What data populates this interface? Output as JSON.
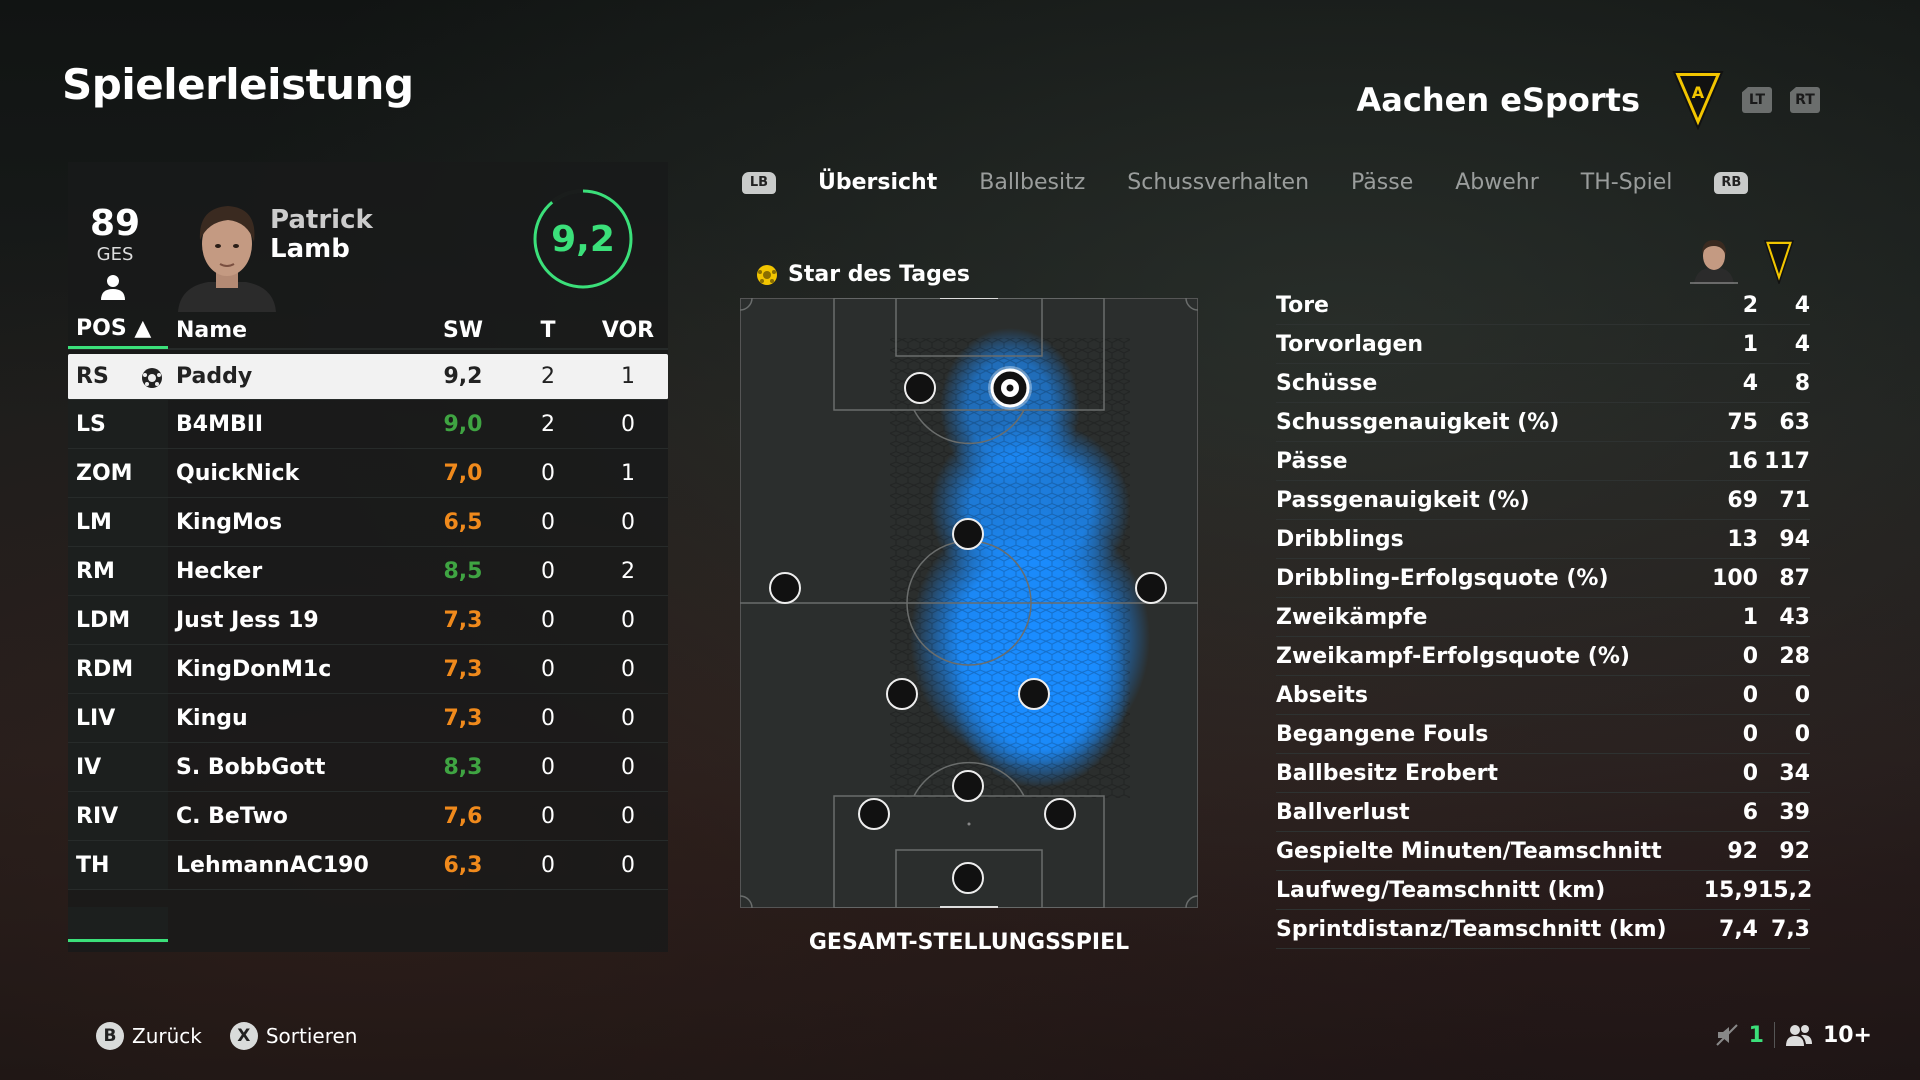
{
  "page_title": "Spielerleistung",
  "team": {
    "name": "Aachen eSports",
    "lt": "LT",
    "rt": "RT"
  },
  "player": {
    "ges_value": "89",
    "ges_label": "GES",
    "first_name": "Patrick",
    "last_name": "Lamb",
    "rating": "9,2"
  },
  "table": {
    "headers": {
      "pos": "POS ▲",
      "name": "Name",
      "sw": "SW",
      "t": "T",
      "vor": "VOR"
    },
    "rows": [
      {
        "pos": "RS",
        "name": "Paddy",
        "sw": "9,2",
        "t": "2",
        "vor": "1",
        "sw_color": "#222222"
      },
      {
        "pos": "LS",
        "name": "B4MBII",
        "sw": "9,0",
        "t": "2",
        "vor": "0",
        "sw_color": "#3fa442"
      },
      {
        "pos": "ZOM",
        "name": "QuickNick",
        "sw": "7,0",
        "t": "0",
        "vor": "1",
        "sw_color": "#f08a1c"
      },
      {
        "pos": "LM",
        "name": "KingMos",
        "sw": "6,5",
        "t": "0",
        "vor": "0",
        "sw_color": "#f08a1c"
      },
      {
        "pos": "RM",
        "name": "Hecker",
        "sw": "8,5",
        "t": "0",
        "vor": "2",
        "sw_color": "#3fa442"
      },
      {
        "pos": "LDM",
        "name": "Just Jess 19",
        "sw": "7,3",
        "t": "0",
        "vor": "0",
        "sw_color": "#f08a1c"
      },
      {
        "pos": "RDM",
        "name": "KingDonM1c",
        "sw": "7,3",
        "t": "0",
        "vor": "0",
        "sw_color": "#f08a1c"
      },
      {
        "pos": "LIV",
        "name": "Kingu",
        "sw": "7,3",
        "t": "0",
        "vor": "0",
        "sw_color": "#f08a1c"
      },
      {
        "pos": "IV",
        "name": "S. BobbGott",
        "sw": "8,3",
        "t": "0",
        "vor": "0",
        "sw_color": "#3fa442"
      },
      {
        "pos": "RIV",
        "name": "C. BeTwo",
        "sw": "7,6",
        "t": "0",
        "vor": "0",
        "sw_color": "#f08a1c"
      },
      {
        "pos": "TH",
        "name": "LehmannAC190",
        "sw": "6,3",
        "t": "0",
        "vor": "0",
        "sw_color": "#f08a1c"
      }
    ]
  },
  "tabs": {
    "lb": "LB",
    "rb": "RB",
    "items": [
      "Übersicht",
      "Ballbesitz",
      "Schussverhalten",
      "Pässe",
      "Abwehr",
      "TH-Spiel"
    ],
    "active": "Übersicht"
  },
  "pitch": {
    "star_label": "Star des Tages",
    "caption": "GESAMT-STELLUNGSSPIEL"
  },
  "stats": [
    {
      "label": "Tore",
      "player": "2",
      "team": "4"
    },
    {
      "label": "Torvorlagen",
      "player": "1",
      "team": "4"
    },
    {
      "label": "Schüsse",
      "player": "4",
      "team": "8"
    },
    {
      "label": "Schussgenauigkeit (%)",
      "player": "75",
      "team": "63"
    },
    {
      "label": "Pässe",
      "player": "16",
      "team": "117"
    },
    {
      "label": "Passgenauigkeit (%)",
      "player": "69",
      "team": "71"
    },
    {
      "label": "Dribblings",
      "player": "13",
      "team": "94"
    },
    {
      "label": "Dribbling-Erfolgsquote (%)",
      "player": "100",
      "team": "87"
    },
    {
      "label": "Zweikämpfe",
      "player": "1",
      "team": "43"
    },
    {
      "label": "Zweikampf-Erfolgsquote (%)",
      "player": "0",
      "team": "28"
    },
    {
      "label": "Abseits",
      "player": "0",
      "team": "0"
    },
    {
      "label": "Begangene Fouls",
      "player": "0",
      "team": "0"
    },
    {
      "label": "Ballbesitz Erobert",
      "player": "0",
      "team": "34"
    },
    {
      "label": "Ballverlust",
      "player": "6",
      "team": "39"
    },
    {
      "label": "Gespielte Minuten/Teamschnitt",
      "player": "92",
      "team": "92"
    },
    {
      "label": "Laufweg/Teamschnitt (km)",
      "player": "15,9",
      "team": "15,2"
    },
    {
      "label": "Sprintdistanz/Teamschnitt (km)",
      "player": "7,4",
      "team": "7,3"
    }
  ],
  "footer": {
    "back_btn": "B",
    "back_label": "Zurück",
    "sort_btn": "X",
    "sort_label": "Sortieren",
    "count": "1",
    "players": "10+"
  },
  "colors": {
    "accent": "#3be07a",
    "heatmap": "#1a8cff"
  }
}
